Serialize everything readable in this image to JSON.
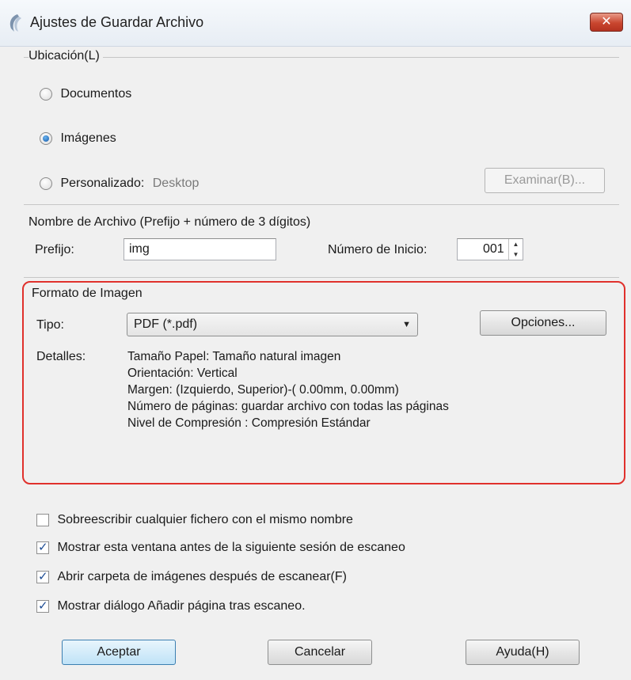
{
  "window": {
    "title": "Ajustes de Guardar Archivo",
    "close_icon": "close-icon"
  },
  "location": {
    "group_label": "Ubicación(L)",
    "options": [
      {
        "label": "Documentos",
        "selected": false
      },
      {
        "label": "Imágenes",
        "selected": true
      },
      {
        "label": "Personalizado:",
        "selected": false
      }
    ],
    "custom_path": "Desktop",
    "browse_button": "Examinar(B)..."
  },
  "filename": {
    "group_label": "Nombre de Archivo (Prefijo + número de 3 dígitos)",
    "prefix_label": "Prefijo:",
    "prefix_value": "img",
    "start_label": "Número de Inicio:",
    "start_value": "001"
  },
  "format": {
    "group_label": "Formato de Imagen",
    "type_label": "Tipo:",
    "type_value": "PDF (*.pdf)",
    "options_button": "Opciones...",
    "details_label": "Detalles:",
    "details": [
      "Tamaño Papel: Tamaño natural imagen",
      "Orientación: Vertical",
      "Margen: (Izquierdo, Superior)-( 0.00mm, 0.00mm)",
      "Número de páginas: guardar archivo con todas las páginas",
      "Nivel de Compresión : Compresión Estándar"
    ],
    "highlight_color": "#e0312c"
  },
  "checkboxes": [
    {
      "label": "Sobreescribir cualquier fichero con el mismo nombre",
      "checked": false
    },
    {
      "label": "Mostrar esta ventana antes de la siguiente sesión de escaneo",
      "checked": true
    },
    {
      "label": "Abrir carpeta de imágenes después de escanear(F)",
      "checked": true
    },
    {
      "label": "Mostrar diálogo Añadir página tras escaneo.",
      "checked": true
    }
  ],
  "buttons": {
    "ok": "Aceptar",
    "cancel": "Cancelar",
    "help": "Ayuda(H)"
  }
}
